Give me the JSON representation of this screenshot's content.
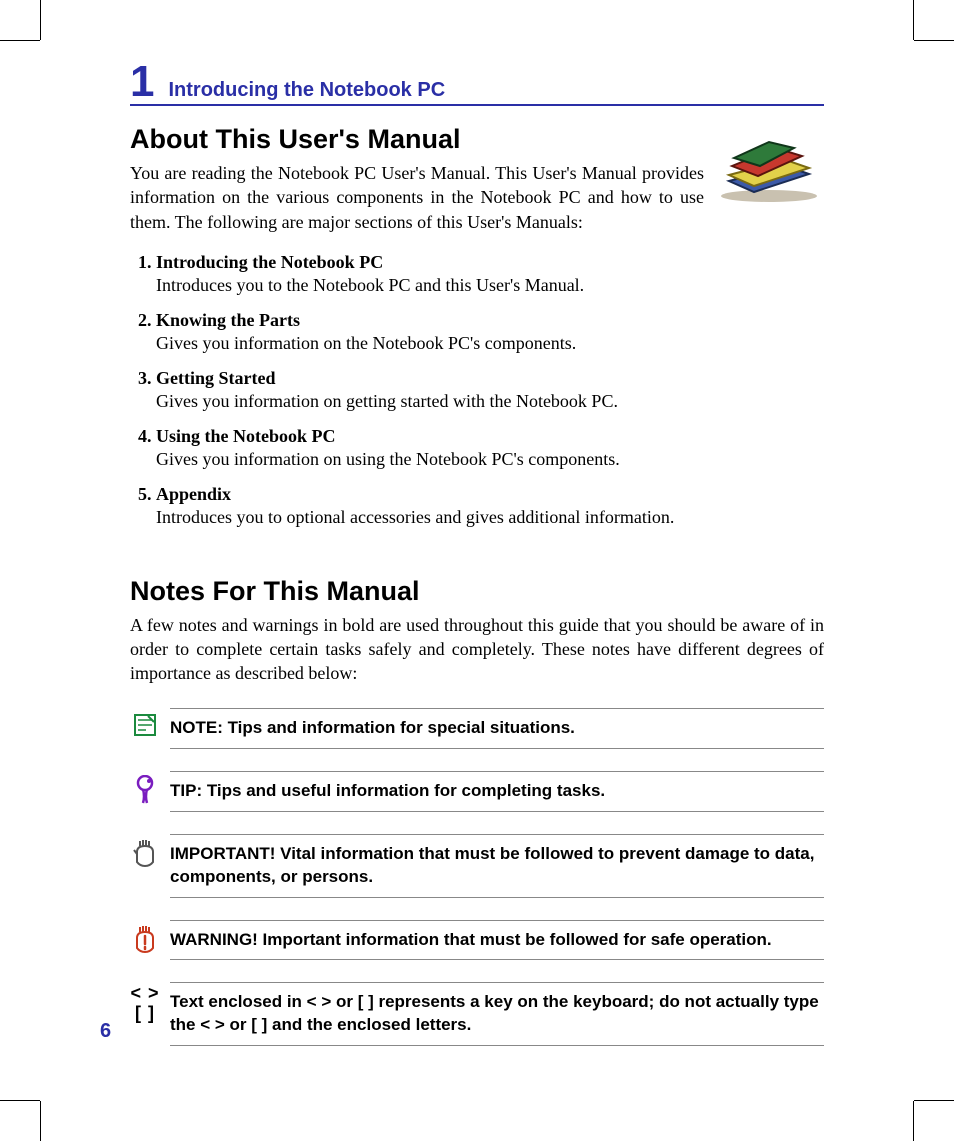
{
  "chapter": {
    "number": "1",
    "title": "Introducing the Notebook PC"
  },
  "section1": {
    "heading": "About This User's Manual",
    "intro": "You are reading the Notebook PC User's Manual. This User's Manual provides information on the various components in the Notebook PC and how to use them. The following are major sections of this User's Manuals:",
    "items": [
      {
        "title": "Introducing the Notebook PC",
        "desc": "Introduces you to the Notebook PC and this User's Manual."
      },
      {
        "title": "Knowing the Parts",
        "desc": "Gives you information on the Notebook PC's components."
      },
      {
        "title": "Getting Started",
        "desc": "Gives you information on getting started with the Notebook PC."
      },
      {
        "title": "Using the Notebook PC",
        "desc": "Gives you information on using the Notebook PC's components."
      },
      {
        "title": "Appendix",
        "desc": "Introduces you to optional accessories and gives additional information."
      }
    ]
  },
  "section2": {
    "heading": "Notes For This Manual",
    "intro": "A few notes and warnings in bold are used throughout this guide that you should be aware of in order to complete certain tasks safely and completely. These notes have different degrees of importance as described below:",
    "callouts": {
      "note": "NOTE: Tips and information for special situations.",
      "tip": "TIP: Tips and useful information for completing tasks.",
      "important": "IMPORTANT! Vital information that must be followed to prevent damage to data, components, or persons.",
      "warning": "WARNING! Important information that must be followed for safe operation.",
      "keys": "Text enclosed in < > or [ ] represents a key on the keyboard; do not actually type the < > or [ ] and the enclosed letters."
    },
    "key_symbols": {
      "line1": "< >",
      "line2": "[  ]"
    }
  },
  "page_number": "6"
}
